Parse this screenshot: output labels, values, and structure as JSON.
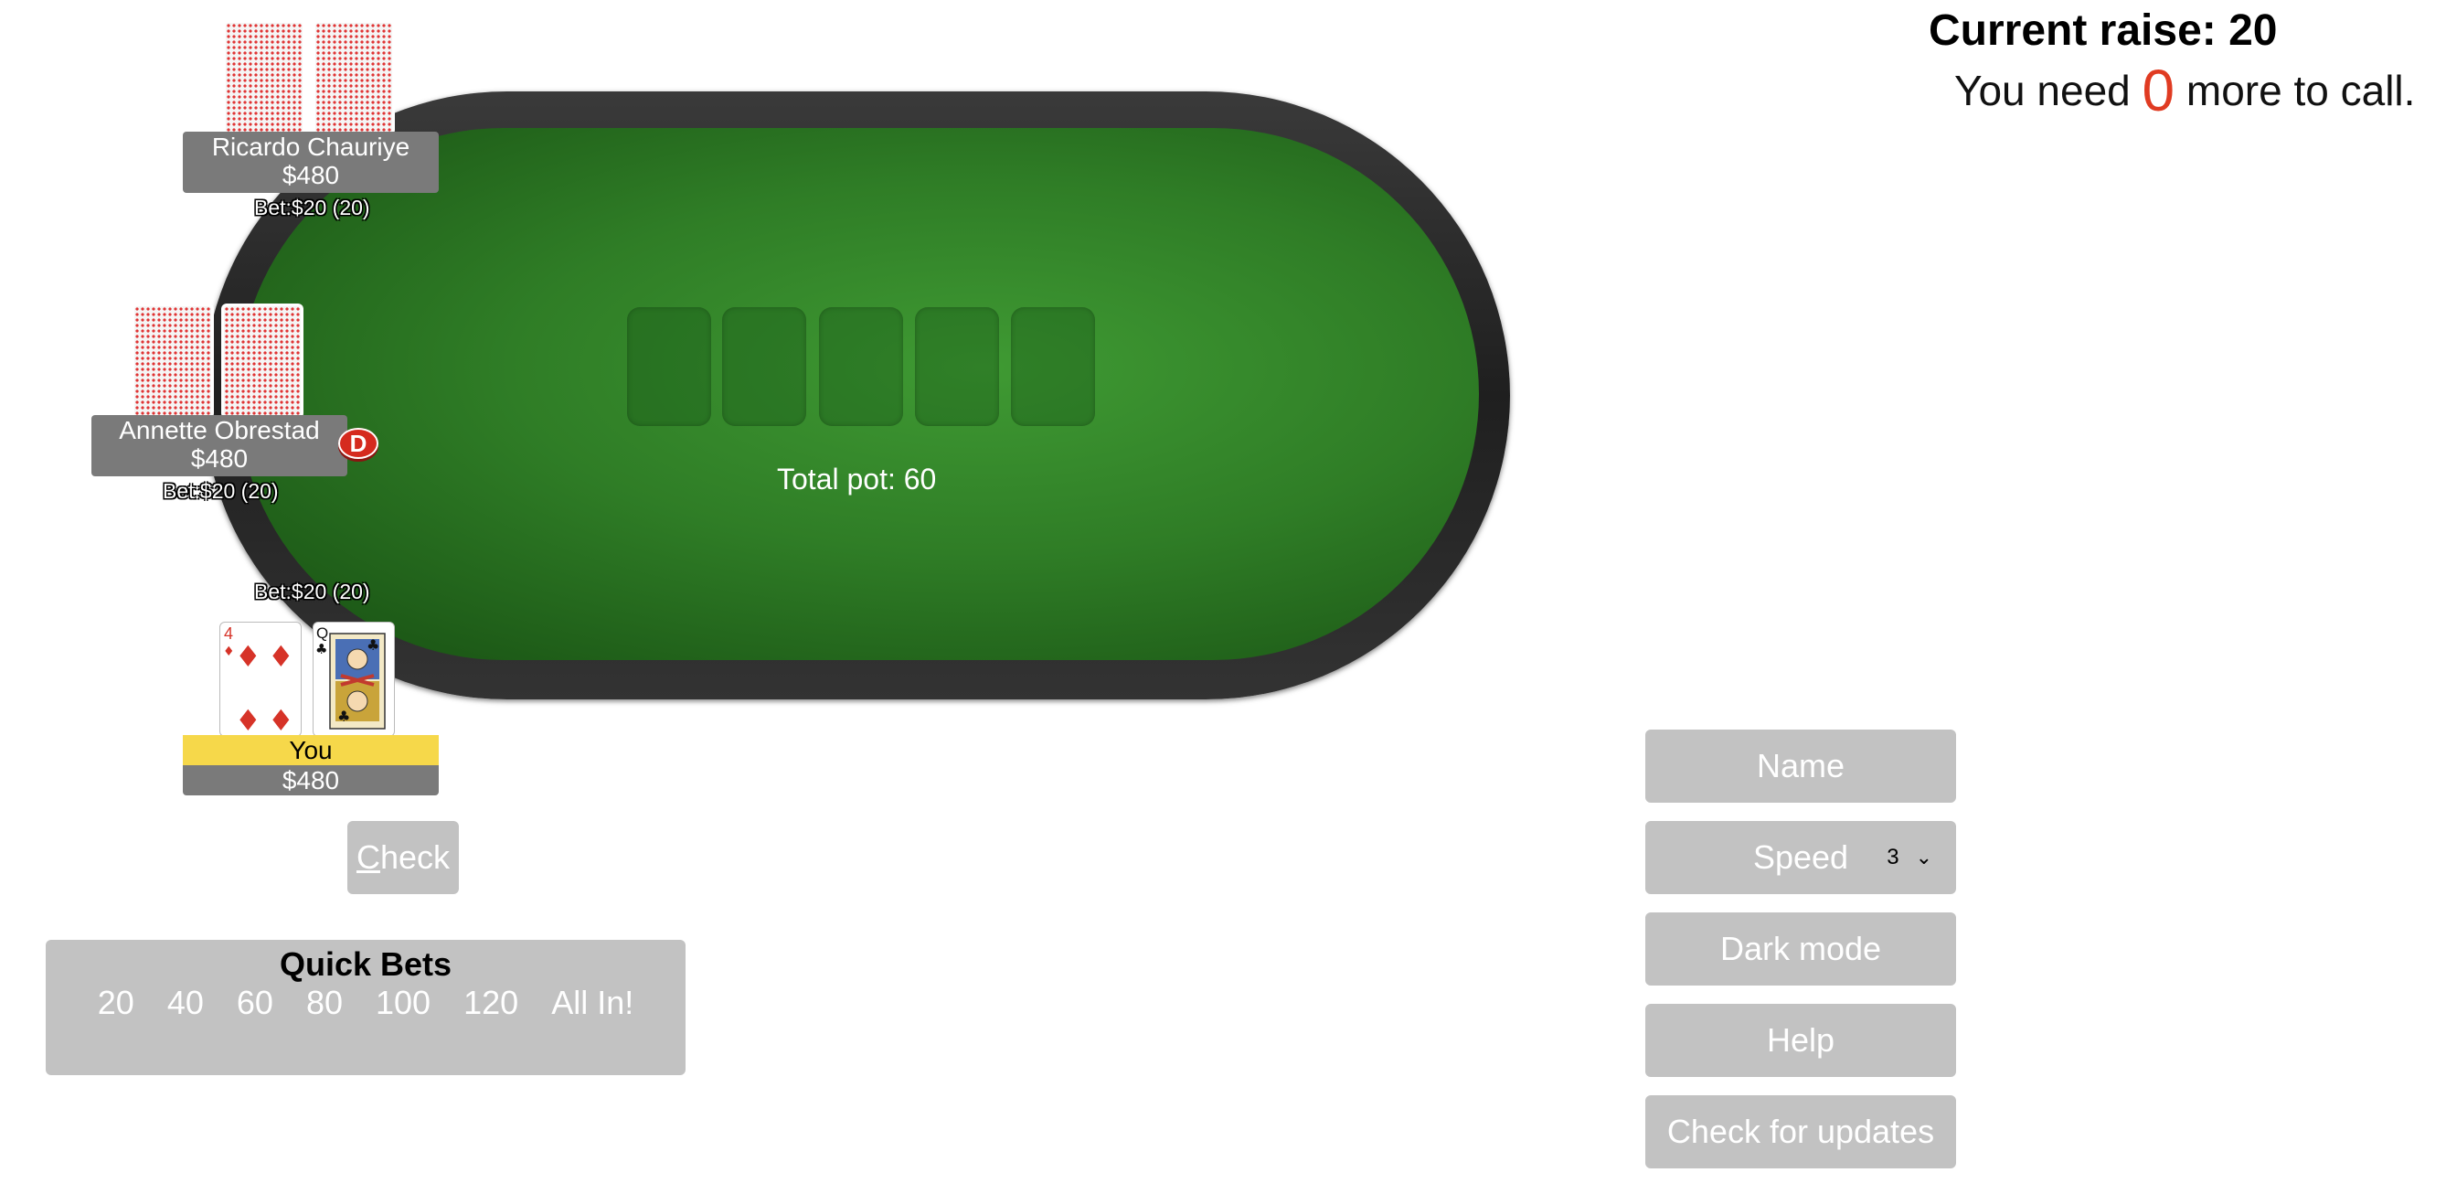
{
  "status": {
    "current_raise": "Current raise: 20",
    "call_prefix": "You need",
    "call_amount": "0",
    "call_suffix": "more to call.",
    "call_amount_color": "#e03b22"
  },
  "table": {
    "total_pot": "Total pot: 60",
    "felt_color": "#2f7d26"
  },
  "players": [
    {
      "name": "Ricardo Chauriye",
      "stack": "$480",
      "bet": "Bet:$20 (20)"
    },
    {
      "name": "Annette Obrestad",
      "stack": "$480",
      "bet": "Bet:$20 (20)"
    }
  ],
  "you": {
    "name": "You",
    "stack": "$480",
    "bet": "Bet:$20 (20)",
    "cards": [
      {
        "rank": "4",
        "suit": "♦",
        "suit_name": "diamonds"
      },
      {
        "rank": "Q",
        "suit": "♣",
        "suit_name": "clubs"
      }
    ]
  },
  "dealer_button": "D",
  "actions": {
    "check_first_letter": "C",
    "check_rest": "heck"
  },
  "quick_bets": {
    "title": "Quick Bets",
    "options": [
      "20",
      "40",
      "60",
      "80",
      "100",
      "120",
      "All In!"
    ]
  },
  "menu": {
    "name": "Name",
    "speed": "Speed",
    "speed_value": "3",
    "dark_mode": "Dark mode",
    "help": "Help",
    "check_updates": "Check for updates"
  }
}
